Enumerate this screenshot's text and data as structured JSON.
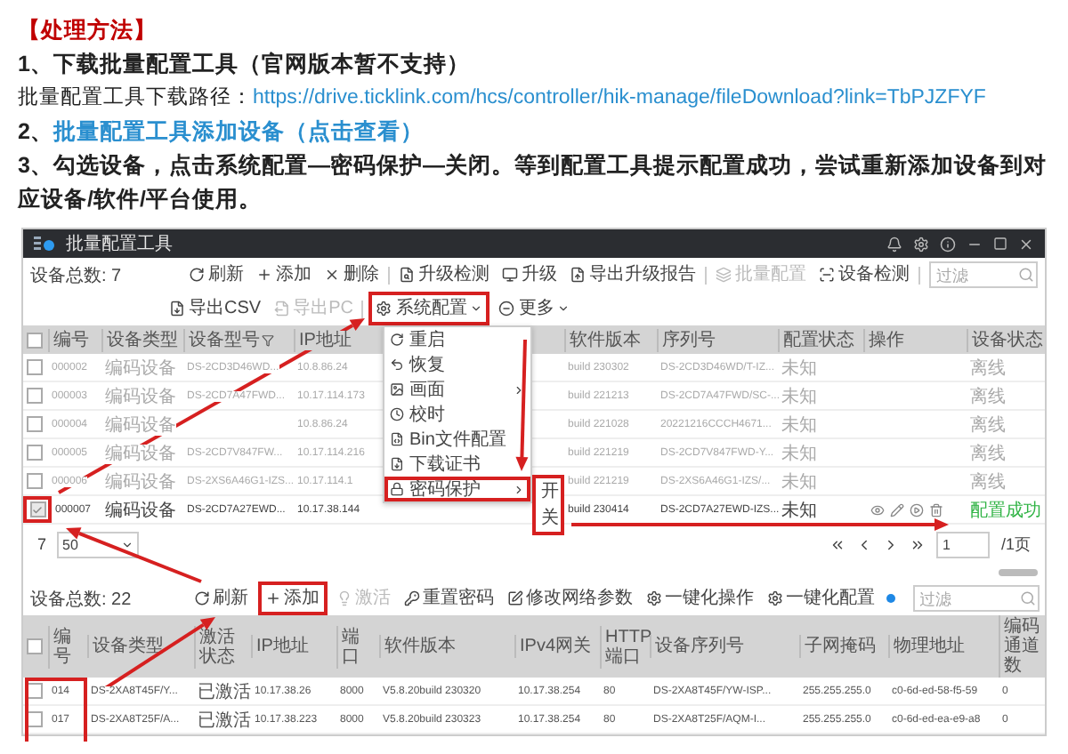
{
  "heading": "【处理方法】",
  "step_1": "1、下载批量配置工具（官网版本暂不支持）",
  "download": {
    "label": "批量配置工具下载路径：",
    "link": "https://drive.ticklink.com/hcs/controller/hik-manage/fileDownload?link=TbPJZFYF"
  },
  "step_2": {
    "number": "2、",
    "link": "批量配置工具添加设备（点击查看）"
  },
  "step_3": "3、勾选设备，点击**系统配置—密码保护—关闭**。等到配置工具提示配置成功，尝试重新添加设备到对应设备/软件/平台使用。",
  "app": {
    "title": "批量配置工具",
    "device_list": {
      "total": "设备总数: 7",
      "toolbar": [
        {
          "label": "刷新",
          "disabled": false
        },
        {
          "label": "添加",
          "disabled": false
        },
        {
          "label": "删除",
          "disabled": false
        },
        {
          "label": "升级检测",
          "disabled": false
        },
        {
          "label": "升级",
          "disabled": false
        },
        {
          "label": "导出升级报告",
          "disabled": false
        },
        {
          "label": "批量配置",
          "disabled": true
        },
        {
          "label": "设备检测",
          "disabled": false
        }
      ],
      "toolbar_2": [
        {
          "label": "导出CSV",
          "disabled": false,
          "dropdown": false,
          "highlighted": false
        },
        {
          "label": "导出PC",
          "disabled": true,
          "dropdown": false,
          "highlighted": false
        },
        {
          "label": "系统配置",
          "disabled": false,
          "dropdown": true,
          "highlighted": true
        },
        {
          "label": "更多",
          "disabled": false,
          "dropdown": true,
          "highlighted": false
        }
      ],
      "search": {
        "placeholder": "过滤"
      },
      "all_checked": false,
      "columns": [
        "编号",
        "设备类型",
        "设备型号",
        "IP地址",
        "软件版本",
        "序列号",
        "配置状态",
        "操作",
        "设备状态"
      ],
      "rows": [
        {
          "cells": [
            "000002",
            "编码设备",
            "DS-2CD3D46WD...",
            "10.8.86.24",
            "build 230302",
            "DS-2CD3D46WD/T-IZ...",
            "未知"
          ],
          "checked": false,
          "dimmed": true,
          "hovered": false,
          "highlighted": false,
          "status": {
            "text": "离线",
            "kind": "plain"
          }
        },
        {
          "cells": [
            "000003",
            "编码设备",
            "DS-2CD7A47FWD...",
            "10.17.114.173",
            "build 221213",
            "DS-2CD7A47FWD/SC-...",
            "未知"
          ],
          "checked": false,
          "dimmed": true,
          "hovered": false,
          "highlighted": false,
          "status": {
            "text": "离线",
            "kind": "plain"
          }
        },
        {
          "cells": [
            "000004",
            "编码设备",
            "",
            "10.8.86.24",
            "build 221028",
            "20221216CCCH4671...",
            "未知"
          ],
          "checked": false,
          "dimmed": true,
          "hovered": false,
          "highlighted": false,
          "status": {
            "text": "离线",
            "kind": "plain"
          }
        },
        {
          "cells": [
            "000005",
            "编码设备",
            "DS-2CD7V847FW...",
            "10.17.114.216",
            "build 221219",
            "DS-2CD7V847FWD-Y...",
            "未知"
          ],
          "checked": false,
          "dimmed": true,
          "hovered": false,
          "highlighted": false,
          "status": {
            "text": "离线",
            "kind": "plain"
          }
        },
        {
          "cells": [
            "000006",
            "编码设备",
            "DS-2XS6A46G1-IZS...",
            "10.17.114.1",
            "build 221219",
            "DS-2XS6A46G1-IZS/...",
            "未知"
          ],
          "checked": false,
          "dimmed": true,
          "hovered": false,
          "highlighted": false,
          "status": {
            "text": "离线",
            "kind": "plain"
          }
        },
        {
          "cells": [
            "000007",
            "编码设备",
            "DS-2CD7A27EWD...",
            "10.17.38.144",
            "build 230414",
            "DS-2CD7A27EWD-IZS...",
            "未知"
          ],
          "checked": true,
          "dimmed": false,
          "hovered": true,
          "highlighted": true,
          "status": {
            "text": "配置成功",
            "kind": "success"
          }
        }
      ],
      "menu": {
        "items": [
          {
            "label": "重启",
            "submenu": false,
            "highlighted": false
          },
          {
            "label": "恢复",
            "submenu": false,
            "highlighted": false
          },
          {
            "label": "画面",
            "submenu": true,
            "highlighted": false
          },
          {
            "label": "校时",
            "submenu": false,
            "highlighted": false
          },
          {
            "label": "Bin文件配置",
            "submenu": false,
            "highlighted": false
          },
          {
            "label": "下载证书",
            "submenu": false,
            "highlighted": false
          },
          {
            "label": "密码保护",
            "submenu": true,
            "highlighted": true
          }
        ],
        "submenu": [
          "开",
          "关"
        ]
      },
      "pagination": {
        "total": "7",
        "page_size": "50",
        "page": "1",
        "pages": "/1页"
      }
    },
    "added_devices": {
      "total": "设备总数: 22",
      "toolbar": [
        {
          "label": "刷新",
          "disabled": false,
          "highlighted": false,
          "dot": false
        },
        {
          "label": "添加",
          "disabled": false,
          "highlighted": true,
          "dot": false
        },
        {
          "label": "激活",
          "disabled": true,
          "highlighted": false,
          "dot": false
        },
        {
          "label": "重置密码",
          "disabled": false,
          "highlighted": false,
          "dot": false
        },
        {
          "label": "修改网络参数",
          "disabled": false,
          "highlighted": false,
          "dot": false
        },
        {
          "label": "一键化操作",
          "disabled": false,
          "highlighted": false,
          "dot": false
        },
        {
          "label": "一键化配置",
          "disabled": false,
          "highlighted": false,
          "dot": true
        }
      ],
      "search": {
        "placeholder": "过滤"
      },
      "all_checked": false,
      "columns": [
        "编号",
        "设备类型",
        "激活状态",
        "IP地址",
        "端口",
        "软件版本",
        "IPv4网关",
        "HTTP端口",
        "设备序列号",
        "子网掩码",
        "物理地址",
        "编码通道数"
      ],
      "rows_highlighted": true,
      "rows": [
        {
          "cells": [
            "014",
            "DS-2XA8T45F/Y...",
            "已激活",
            "10.17.38.26",
            "8000",
            "V5.8.20build 230320",
            "10.17.38.254",
            "80",
            "DS-2XA8T45F/YW-ISP...",
            "255.255.255.0",
            "c0-6d-ed-58-f5-59",
            "0"
          ],
          "checked": false
        },
        {
          "cells": [
            "017",
            "DS-2XA8T25F/A...",
            "已激活",
            "10.17.38.223",
            "8000",
            "V5.8.20build 230323",
            "10.17.38.254",
            "80",
            "DS-2XA8T25F/AQM-I...",
            "255.255.255.0",
            "c0-6d-ed-ea-e9-a8",
            "0"
          ],
          "checked": false
        }
      ]
    }
  }
}
